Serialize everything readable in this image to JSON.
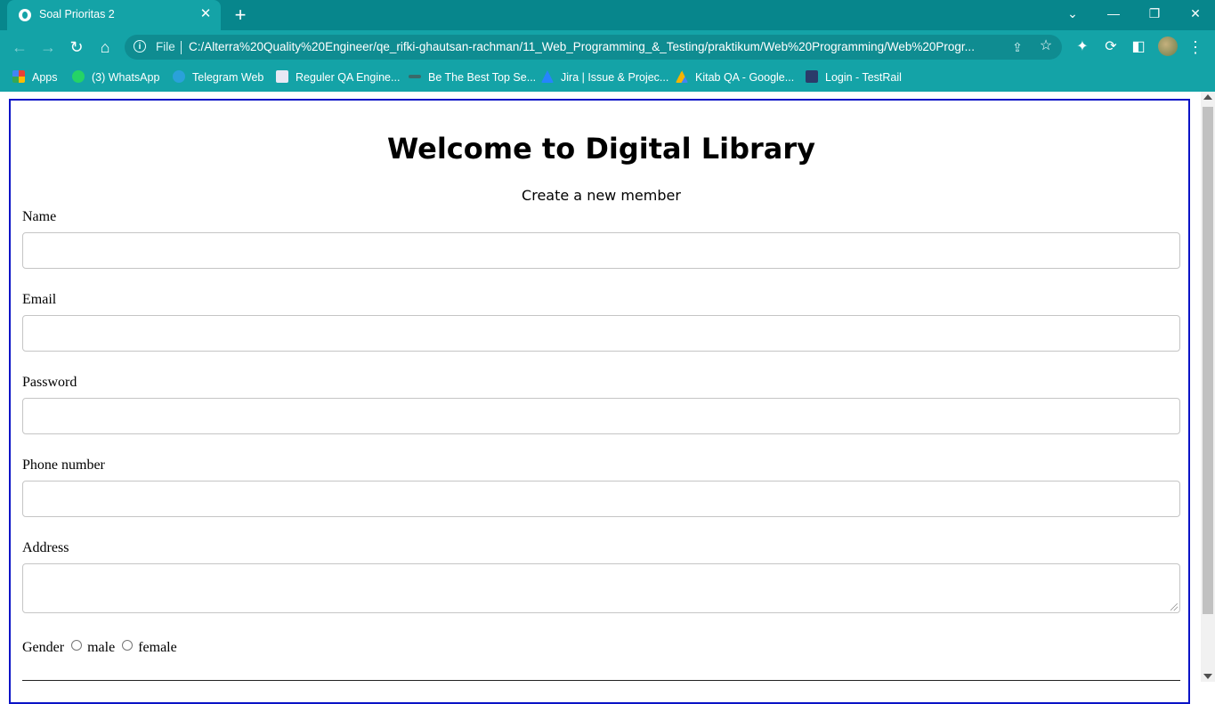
{
  "browser": {
    "tab": {
      "title": "Soal Prioritas 2",
      "favicon": "globe-icon"
    },
    "window_controls": [
      "chevron-down-icon",
      "minimize-icon",
      "restore-icon",
      "close-icon"
    ],
    "omnibox": {
      "scheme": "File",
      "url": "C:/Alterra%20Quality%20Engineer/qe_rifki-ghautsan-rachman/11_Web_Programming_&_Testing/praktikum/Web%20Programming/Web%20Progr..."
    },
    "bookmarks": [
      {
        "label": "Apps",
        "icon": "apps-grid-icon"
      },
      {
        "label": "(3) WhatsApp",
        "icon": "whatsapp-icon"
      },
      {
        "label": "Telegram Web",
        "icon": "telegram-icon"
      },
      {
        "label": "Reguler QA Engine...",
        "icon": "bookmark-page-icon"
      },
      {
        "label": "Be The Best Top Se...",
        "icon": "bookmark-page-icon"
      },
      {
        "label": "Jira | Issue & Projec...",
        "icon": "jira-icon"
      },
      {
        "label": "Kitab QA - Google...",
        "icon": "google-drive-icon"
      },
      {
        "label": "Login - TestRail",
        "icon": "testrail-icon"
      }
    ],
    "accent": "#14a3a7",
    "tabstrip_color": "#07868c"
  },
  "page": {
    "heading": "Welcome to Digital Library",
    "subtitle": "Create a new member",
    "fields": [
      {
        "label": "Name",
        "value": ""
      },
      {
        "label": "Email",
        "value": ""
      },
      {
        "label": "Password",
        "value": ""
      },
      {
        "label": "Phone number",
        "value": ""
      },
      {
        "label": "Address",
        "value": ""
      }
    ],
    "gender": {
      "label": "Gender",
      "options": [
        "male",
        "female"
      ],
      "selected": null
    },
    "frame_border_color": "#0a13c6"
  }
}
